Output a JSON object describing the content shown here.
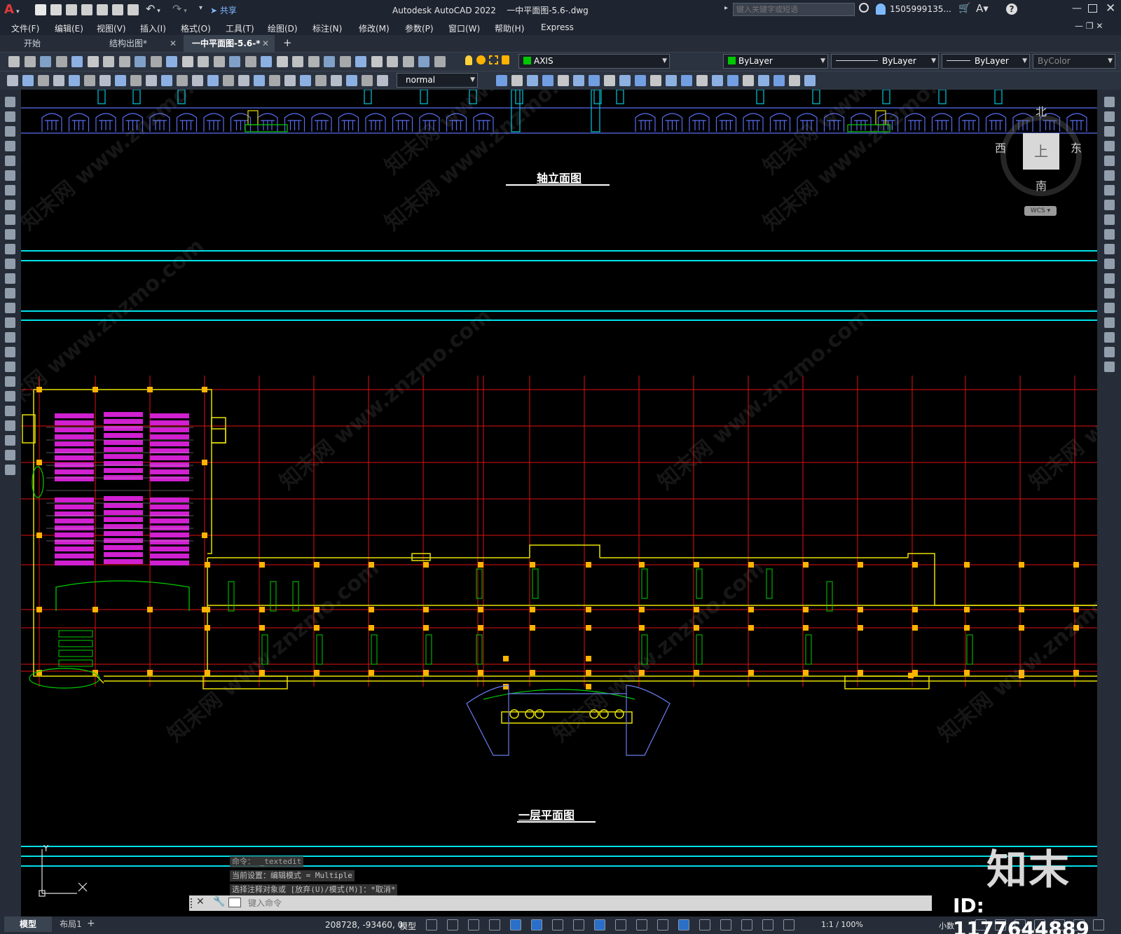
{
  "title_bar": {
    "app_name": "Autodesk AutoCAD 2022",
    "file_name": "一中平面图-5.6-.dwg",
    "search_placeholder": "键入关键字或短语",
    "user": "1505999135...",
    "share": "共享"
  },
  "menus": [
    "文件(F)",
    "编辑(E)",
    "视图(V)",
    "插入(I)",
    "格式(O)",
    "工具(T)",
    "绘图(D)",
    "标注(N)",
    "修改(M)",
    "参数(P)",
    "窗口(W)",
    "帮助(H)",
    "Express"
  ],
  "tabs": [
    {
      "label": "开始"
    },
    {
      "label": "结构出图*"
    },
    {
      "label": "一中平面图-5.6-*"
    }
  ],
  "toolbar": {
    "layer_name": "AXIS",
    "layer_color": "#00c800",
    "color_combo": "ByLayer",
    "linetype_combo": "ByLayer",
    "lineweight_combo": "ByLayer",
    "plotstyle_combo": "ByColor",
    "text_style": "normal"
  },
  "viewcube": {
    "north": "北",
    "south": "南",
    "east": "东",
    "west": "西",
    "top": "上",
    "wcs": "WCS"
  },
  "drawing": {
    "elevation_title": "轴立面图",
    "plan_title": "一层平面图",
    "axis_y": "Y"
  },
  "command_history": [
    "命令： _textedit",
    "当前设置：编辑模式 = Multiple",
    "选择注释对象或 [放弃(U)/模式(M)]：*取消*"
  ],
  "command_placeholder": "键入命令",
  "layout_tabs": [
    "模型",
    "布局1"
  ],
  "status": {
    "coordinates": "208728, -93460, 0",
    "model": "模型",
    "scale": "1:1 / 100%",
    "units": "小数"
  },
  "branding": {
    "logo": "知末",
    "id_label": "ID: 1177644889",
    "watermark": "知末网 www.znzmo.com"
  }
}
